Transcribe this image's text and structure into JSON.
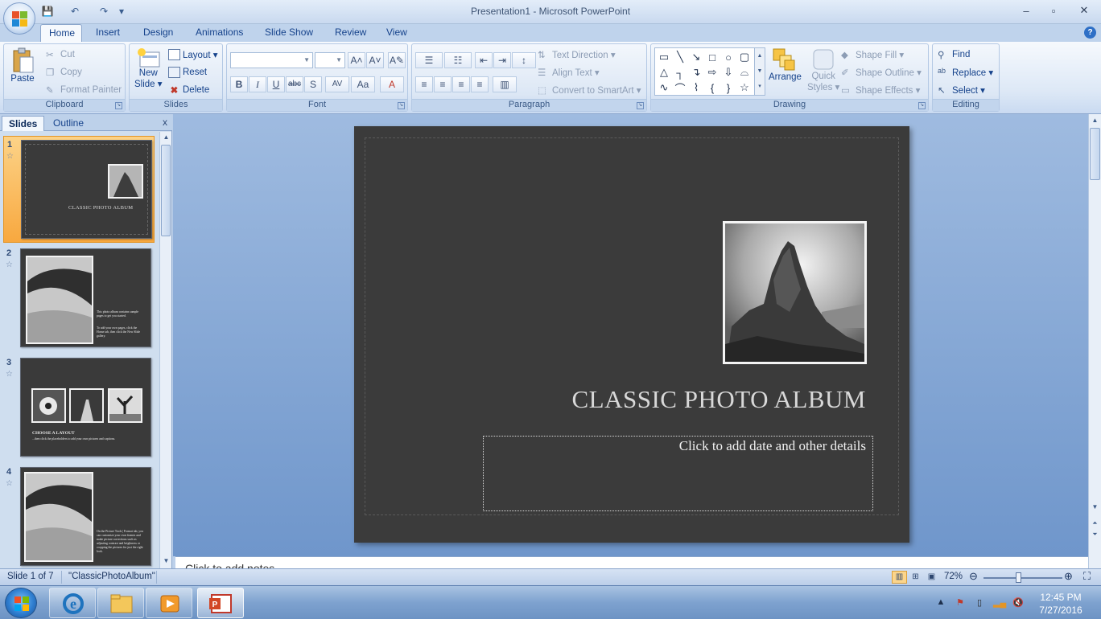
{
  "window": {
    "title": "Presentation1 - Microsoft PowerPoint",
    "minimize": "–",
    "maximize": "▫",
    "close": "✕"
  },
  "qat": {
    "save": "💾",
    "undo": "↶",
    "redo": "↷",
    "customize": "▾"
  },
  "tabs": [
    "Home",
    "Insert",
    "Design",
    "Animations",
    "Slide Show",
    "Review",
    "View"
  ],
  "help": "?",
  "ribbon": {
    "clipboard": {
      "label": "Clipboard",
      "paste": "Paste",
      "cut": "Cut",
      "copy": "Copy",
      "format_painter": "Format Painter"
    },
    "slides": {
      "label": "Slides",
      "new_slide": "New",
      "new_slide_2": "Slide ▾",
      "layout": "Layout ▾",
      "reset": "Reset",
      "delete": "Delete"
    },
    "font": {
      "label": "Font",
      "bold": "B",
      "italic": "I",
      "underline": "U",
      "strike": "abc",
      "shadow": "S",
      "spacing": "AV",
      "case": "Aa",
      "color": "A",
      "grow": "A˄",
      "shrink": "A˅",
      "clear": "A✎"
    },
    "paragraph": {
      "label": "Paragraph",
      "text_direction": "Text Direction ▾",
      "align_text": "Align Text ▾",
      "smartart": "Convert to SmartArt ▾"
    },
    "drawing": {
      "label": "Drawing",
      "arrange": "Arrange",
      "quick_styles": "Quick",
      "quick_styles_2": "Styles ▾",
      "shape_fill": "Shape Fill ▾",
      "shape_outline": "Shape Outline ▾",
      "shape_effects": "Shape Effects ▾"
    },
    "editing": {
      "label": "Editing",
      "find": "Find",
      "replace": "Replace ▾",
      "select": "Select ▾"
    }
  },
  "pane": {
    "tab_slides": "Slides",
    "tab_outline": "Outline",
    "close": "x"
  },
  "thumbnails": [
    {
      "num": "1",
      "title": "CLASSIC PHOTO ALBUM"
    },
    {
      "num": "2",
      "text1": "This photo album contains sample pages to get you started.",
      "text2": "To add your own pages, click the Home tab, then click the New Slide gallery."
    },
    {
      "num": "3",
      "title": "CHOOSE A LAYOUT",
      "text": "...then click the placeholders to add your own pictures and captions."
    },
    {
      "num": "4",
      "text": "On the Picture Tools | Format tab, you can customize your own frames and make picture corrections such as adjusting contrast and brightness or cropping the pictures for just the right look."
    }
  ],
  "slide": {
    "title": "CLASSIC PHOTO ALBUM",
    "subtitle_placeholder": "Click to add date and other details"
  },
  "notes_placeholder": "Click to add notes",
  "status": {
    "slide_position": "Slide 1 of 7",
    "theme": "\"ClassicPhotoAlbum\"",
    "zoom": "72%",
    "zoom_level": 0.45
  },
  "clock": {
    "time": "12:45 PM",
    "date": "7/27/2016"
  },
  "colors": {
    "selected_thumb": "#f8a83f",
    "slide_bg": "#3b3b3b",
    "ribbon_text": "#15428b"
  }
}
